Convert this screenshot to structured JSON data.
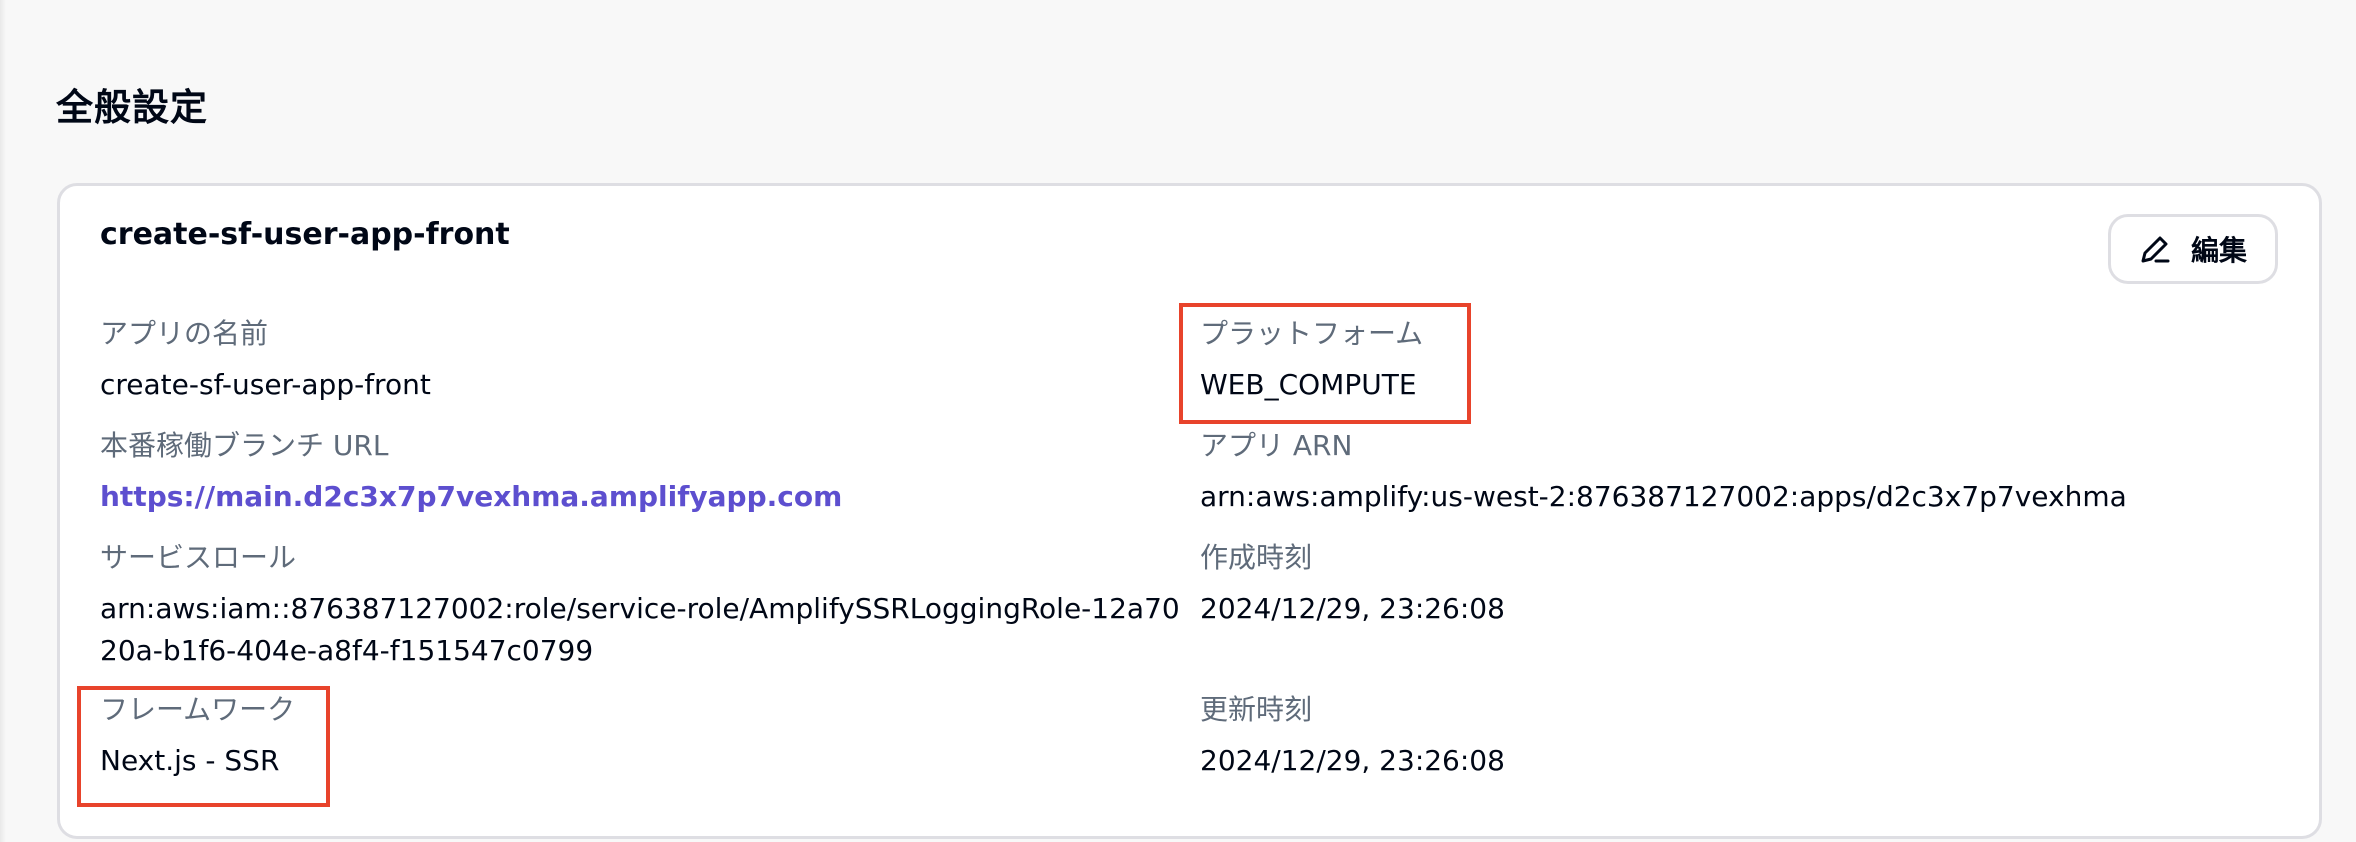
{
  "page": {
    "title": "全般設定"
  },
  "panel": {
    "title": "create-sf-user-app-front",
    "edit_button_label": "編集",
    "edit_icon": "pencil-icon"
  },
  "fields": {
    "app_name": {
      "label": "アプリの名前",
      "value": "create-sf-user-app-front"
    },
    "platform": {
      "label": "プラットフォーム",
      "value": "WEB_COMPUTE"
    },
    "production_branch_url": {
      "label": "本番稼働ブランチ URL",
      "value": "https://main.d2c3x7p7vexhma.amplifyapp.com"
    },
    "app_arn": {
      "label": "アプリ ARN",
      "value": "arn:aws:amplify:us-west-2:876387127002:apps/d2c3x7p7vexhma"
    },
    "service_role": {
      "label": "サービスロール",
      "value": "arn:aws:iam::876387127002:role/service-role/AmplifySSRLoggingRole-12a7020a-b1f6-404e-a8f4-f151547c0799"
    },
    "created_at": {
      "label": "作成時刻",
      "value": "2024/12/29, 23:26:08"
    },
    "framework": {
      "label": "フレームワーク",
      "value": "Next.js - SSR"
    },
    "updated_at": {
      "label": "更新時刻",
      "value": "2024/12/29, 23:26:08"
    }
  },
  "colors": {
    "link": "#5d4fcf",
    "label": "#5f6b7a",
    "highlight": "#e8432b",
    "panel_border": "#dedee3",
    "background": "#f8f8f8"
  }
}
